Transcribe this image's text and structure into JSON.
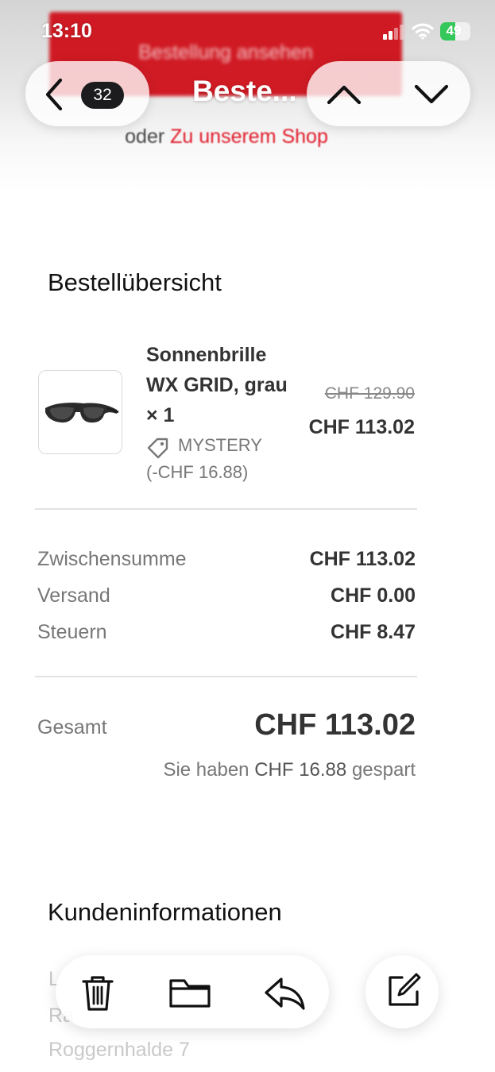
{
  "status_bar": {
    "time": "13:10",
    "battery": "49",
    "battery_level": 0.49
  },
  "header": {
    "message_count": "32",
    "subject": "Beste..."
  },
  "email_banner": {
    "button_label": "Bestellung ansehen",
    "or_text": "oder",
    "shop_link": "Zu unserem Shop"
  },
  "order_summary": {
    "title": "Bestellübersicht",
    "item": {
      "name": "Sonnenbrille WX GRID, grau × 1",
      "discount_code": "MYSTERY",
      "discount_amount": "(-CHF 16.88)",
      "original_price": "CHF 129.90",
      "price": "CHF 113.02"
    },
    "rows": [
      {
        "label": "Zwischensumme",
        "value": "CHF 113.02"
      },
      {
        "label": "Versand",
        "value": "CHF 0.00"
      },
      {
        "label": "Steuern",
        "value": "CHF 8.47"
      }
    ],
    "total_label": "Gesamt",
    "total_value": "CHF 113.02",
    "savings_prefix": "Sie haben",
    "savings_amount": "CHF 16.88",
    "savings_suffix": "gespart"
  },
  "customer_info": {
    "title": "Kundeninformationen",
    "lines": [
      "L",
      "Ra",
      "Roggernhalde 7"
    ]
  },
  "toolbar": {
    "icons": [
      "trash-icon",
      "folder-icon",
      "reply-icon"
    ],
    "compose_icon": "compose-icon"
  }
}
